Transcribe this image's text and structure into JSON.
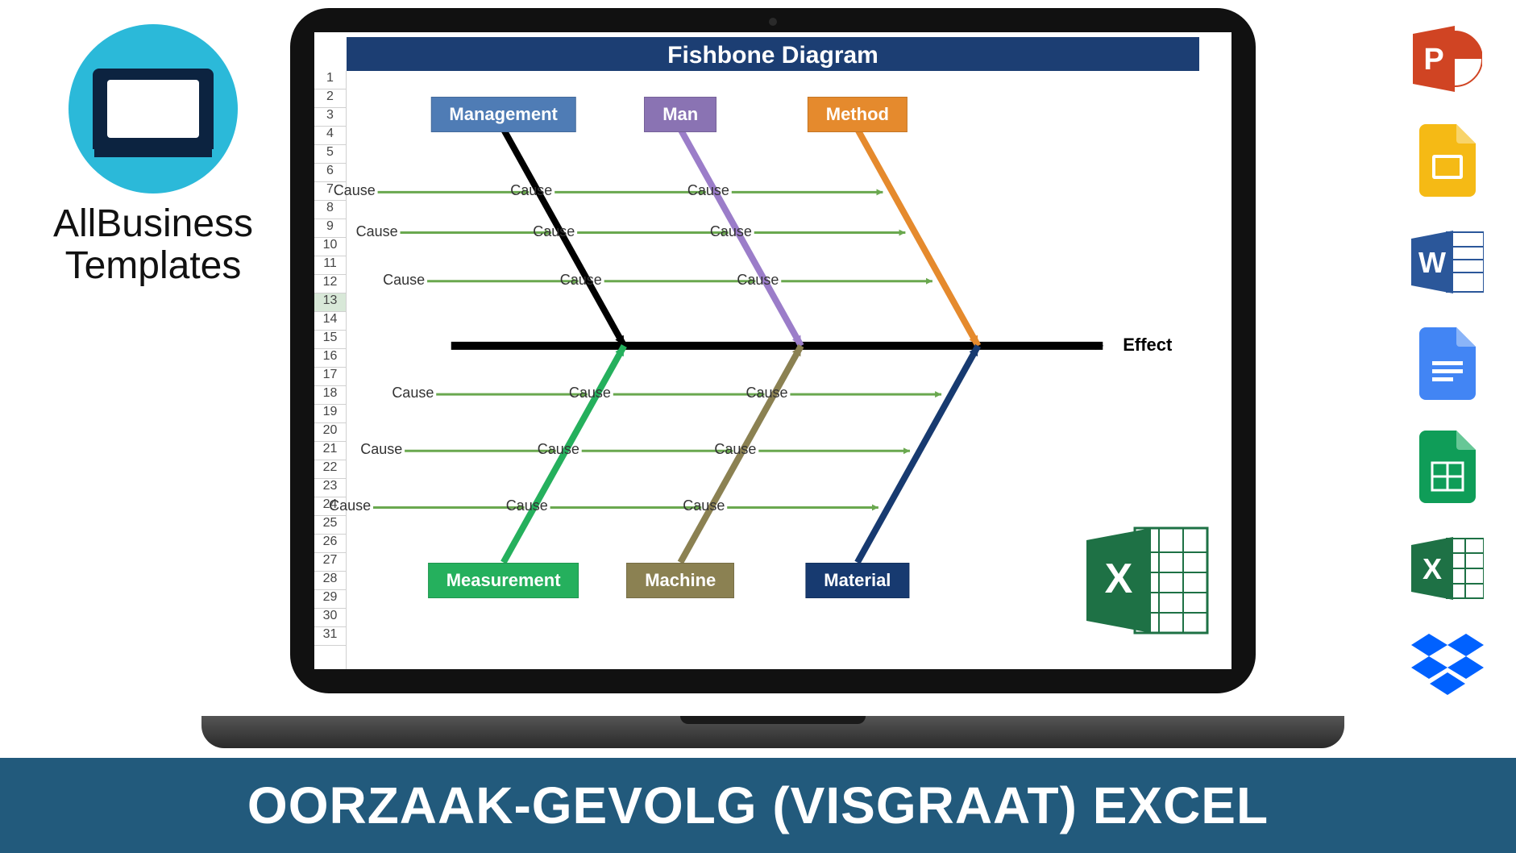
{
  "brand": {
    "name": "AllBusiness\nTemplates"
  },
  "rows": 31,
  "selected_row": 13,
  "diagram": {
    "title": "Fishbone Diagram",
    "spine": {
      "effect_label": "Effect"
    },
    "categories_top": [
      {
        "label": "Management",
        "color": "#4f7cb5",
        "bone_color": "#000000"
      },
      {
        "label": "Man",
        "color": "#8a73b3",
        "bone_color": "#9b7dc9"
      },
      {
        "label": "Method",
        "color": "#e58a2d",
        "bone_color": "#e58a2d"
      }
    ],
    "categories_bottom": [
      {
        "label": "Measurement",
        "color": "#25b05d",
        "bone_color": "#25b05d"
      },
      {
        "label": "Machine",
        "color": "#8b8152",
        "bone_color": "#8b8152"
      },
      {
        "label": "Material",
        "color": "#173a70",
        "bone_color": "#173a70"
      }
    ],
    "cause_label": "Cause",
    "causes_per_bone": 3
  },
  "apps": {
    "list": [
      "powerpoint",
      "google-slides",
      "word",
      "google-docs",
      "google-sheets",
      "excel",
      "dropbox"
    ]
  },
  "footer": {
    "text": "OORZAAK-GEVOLG (VISGRAAT) EXCEL"
  }
}
